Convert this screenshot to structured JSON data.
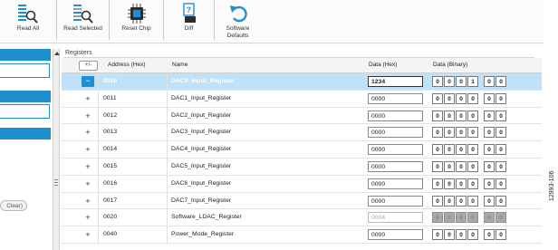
{
  "toolbar": {
    "buttons": [
      {
        "label": "Read All",
        "icon": "read-all-icon"
      },
      {
        "label": "Read Selected",
        "icon": "read-selected-icon"
      },
      {
        "label": "Reset Chip",
        "icon": "chip-icon"
      },
      {
        "label": "Diff",
        "icon": "diff-icon"
      },
      {
        "label_line1": "Software",
        "label_line2": "Defaults",
        "icon": "undo-icon"
      }
    ]
  },
  "left_panel": {
    "clear_label": "Clear)"
  },
  "registers": {
    "title": "Registers",
    "columns": {
      "expand": "+/-",
      "address": "Address (Hex)",
      "name": "Name",
      "data_hex": "Data (Hex)",
      "data_binary": "Data (Binary)"
    },
    "rows": [
      {
        "toggle": "−",
        "address": "0010",
        "name": "DAC0_Input_Register",
        "hex": "1234",
        "bits": [
          "0",
          "0",
          "0",
          "1",
          "0",
          "0"
        ]
      },
      {
        "toggle": "+",
        "address": "0011",
        "name": "DAC1_Input_Register",
        "hex": "0000",
        "bits": [
          "0",
          "0",
          "0",
          "0",
          "0",
          "0"
        ]
      },
      {
        "toggle": "+",
        "address": "0012",
        "name": "DAC2_Input_Register",
        "hex": "0000",
        "bits": [
          "0",
          "0",
          "0",
          "0",
          "0",
          "0"
        ]
      },
      {
        "toggle": "+",
        "address": "0013",
        "name": "DAC3_Input_Register",
        "hex": "0000",
        "bits": [
          "0",
          "0",
          "0",
          "0",
          "0",
          "0"
        ]
      },
      {
        "toggle": "+",
        "address": "0014",
        "name": "DAC4_Input_Register",
        "hex": "0000",
        "bits": [
          "0",
          "0",
          "0",
          "0",
          "0",
          "0"
        ]
      },
      {
        "toggle": "+",
        "address": "0015",
        "name": "DAC5_Input_Register",
        "hex": "0000",
        "bits": [
          "0",
          "0",
          "0",
          "0",
          "0",
          "0"
        ]
      },
      {
        "toggle": "+",
        "address": "0016",
        "name": "DAC6_Input_Register",
        "hex": "0000",
        "bits": [
          "0",
          "0",
          "0",
          "0",
          "0",
          "0"
        ]
      },
      {
        "toggle": "+",
        "address": "0017",
        "name": "DAC7_Input_Register",
        "hex": "0000",
        "bits": [
          "0",
          "0",
          "0",
          "0",
          "0",
          "0"
        ]
      },
      {
        "toggle": "+",
        "address": "0020",
        "name": "Software_LDAC_Register",
        "hex": "0004",
        "bits": [
          "0",
          "0",
          "0",
          "0",
          "0",
          "0"
        ]
      },
      {
        "toggle": "+",
        "address": "0040",
        "name": "Power_Mode_Register",
        "hex": "0000",
        "bits": [
          "0",
          "0",
          "0",
          "0",
          "0",
          "0"
        ]
      }
    ]
  },
  "figure_id": "12993-106",
  "colors": {
    "accent": "#1f8fd0",
    "selected_row": "#bfe1fa",
    "disabled_bits": "#a9a9a9"
  }
}
